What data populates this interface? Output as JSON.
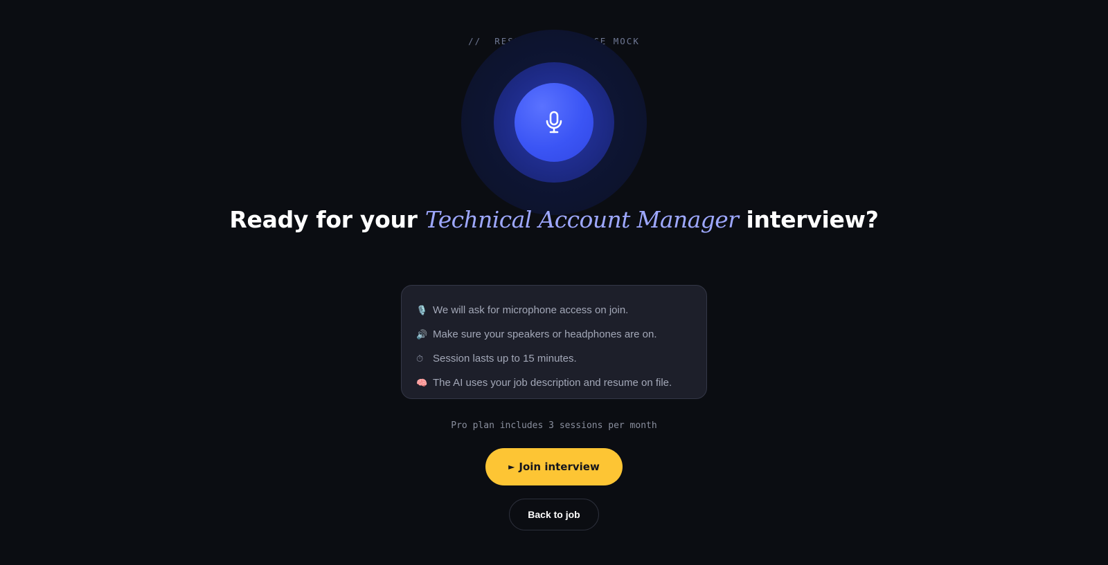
{
  "eyebrow": {
    "prefix": "//",
    "brand": "RESIMAY",
    "separator": "·",
    "section": "VOICE MOCK"
  },
  "mic": {
    "icon": "microphone-icon",
    "core_color": "#3b55f5",
    "ring_color": "#1d2a86"
  },
  "headline": {
    "before": "Ready for your",
    "role": "Technical Account Manager",
    "after": "interview?"
  },
  "info": {
    "items": [
      {
        "icon": "🎙️",
        "text": "We will ask for microphone access on join."
      },
      {
        "icon": "🔊",
        "text": "Make sure your speakers or headphones are on."
      },
      {
        "icon": "⏱",
        "text": "Session lasts up to 15 minutes."
      },
      {
        "icon": "🧠",
        "text": "The AI uses your job description and resume on file."
      }
    ]
  },
  "plan_note": "Pro plan includes 3 sessions per month",
  "actions": {
    "join_icon": "►",
    "join_label": "Join interview",
    "join_color": "#fdc534",
    "back_label": "Back to job"
  }
}
